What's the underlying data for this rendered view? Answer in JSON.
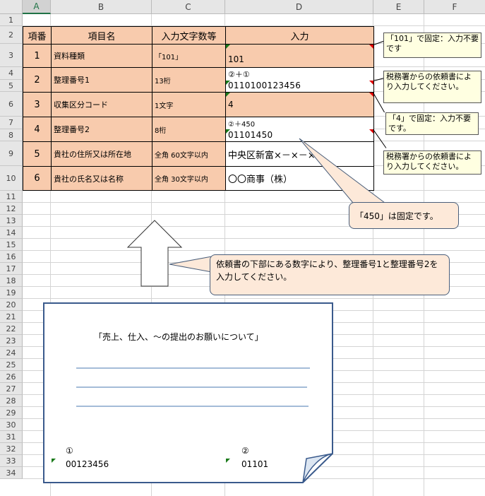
{
  "columns": [
    "A",
    "B",
    "C",
    "D",
    "E",
    "F"
  ],
  "rows": [
    "1",
    "2",
    "3",
    "4",
    "5",
    "6",
    "7",
    "8",
    "9",
    "10",
    "11",
    "12",
    "13",
    "14",
    "15",
    "16",
    "17",
    "18",
    "19",
    "20",
    "21",
    "22",
    "23",
    "24",
    "25",
    "26",
    "27",
    "28",
    "29",
    "30",
    "31",
    "32",
    "33",
    "34"
  ],
  "table": {
    "headers": [
      "項番",
      "項目名",
      "入力文字数等",
      "入力"
    ],
    "r1": {
      "no": "1",
      "name": "資料種類",
      "len": "「101」",
      "input": "101"
    },
    "r2": {
      "no": "2",
      "name": "整理番号1",
      "len": "13桁",
      "hint": "②＋①",
      "input": "0110100123456"
    },
    "r3": {
      "no": "3",
      "name": "収集区分コード",
      "len": "1文字",
      "input": "4"
    },
    "r4": {
      "no": "4",
      "name": "整理番号2",
      "len": "8桁",
      "hint": "②＋450",
      "input": "01101450"
    },
    "r5": {
      "no": "5",
      "name": "貴社の住所又は所在地",
      "len": "全角 60文字以内",
      "input": "中央区新富×－×－×"
    },
    "r6": {
      "no": "6",
      "name": "貴社の氏名又は名称",
      "len": "全角 30文字以内",
      "input": "〇〇商事（株）"
    }
  },
  "comments": {
    "c1": "「101」で固定：入力不要です",
    "c2": "税務署からの依頼書により入力してください。",
    "c3": "「4」で固定：入力不要です。",
    "c4": "税務署からの依頼書により入力してください。"
  },
  "callouts": {
    "fixed450": "「450」は固定です。",
    "instruction": "依頼書の下部にある数字により、整理番号1と整理番号2を入力してください。"
  },
  "doc": {
    "title": "「売上、仕入、～の提出のお願いについて」",
    "mark1": "①",
    "num1": "00123456",
    "mark2": "②",
    "num2": "01101"
  },
  "colors": {
    "orange": "#f8cbad",
    "note": "#ffffe1",
    "callout": "#fde9d9",
    "doc_border": "#3a5a8c",
    "doc_lines": "#4a7ab0"
  }
}
